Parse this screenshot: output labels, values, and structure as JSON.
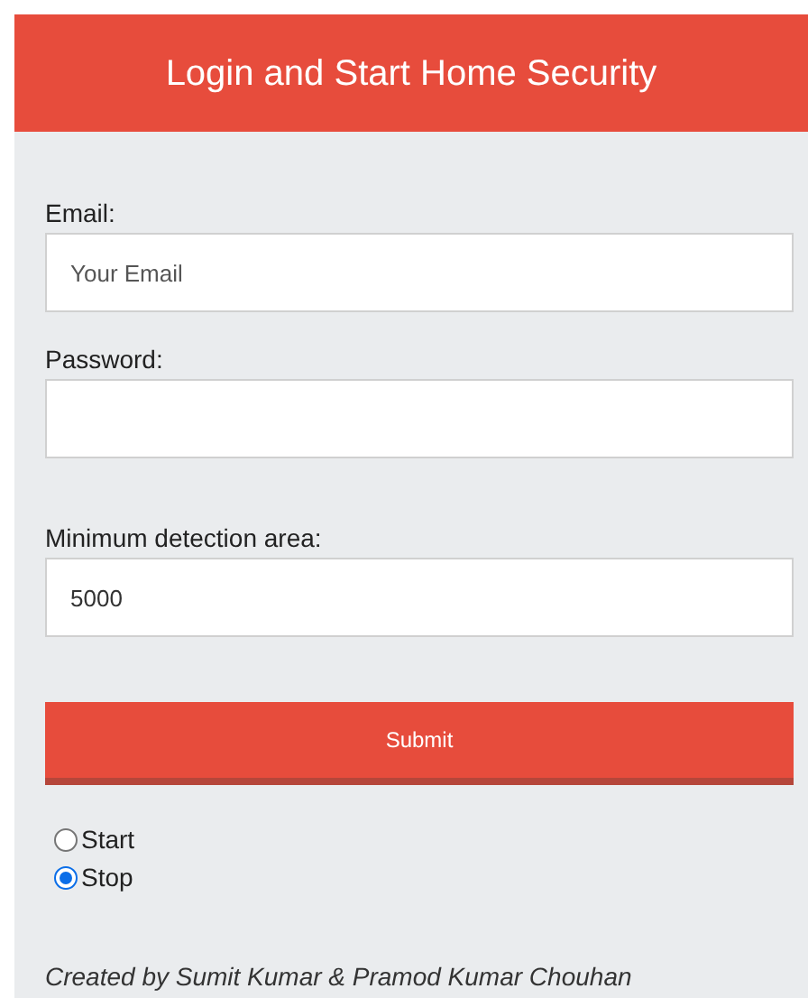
{
  "header": {
    "title": "Login and Start Home Security"
  },
  "fields": [
    {
      "label": "Email:",
      "placeholder": "Your Email"
    },
    {
      "label": "Password:"
    },
    {
      "label": "Minimum detection area:",
      "value": "5000"
    }
  ],
  "submit": {
    "label": "Submit"
  },
  "mode": [
    {
      "label": "Start",
      "selected": false
    },
    {
      "label": "Stop",
      "selected": true
    }
  ],
  "footer": "Created by Sumit Kumar & Pramod Kumar Chouhan"
}
